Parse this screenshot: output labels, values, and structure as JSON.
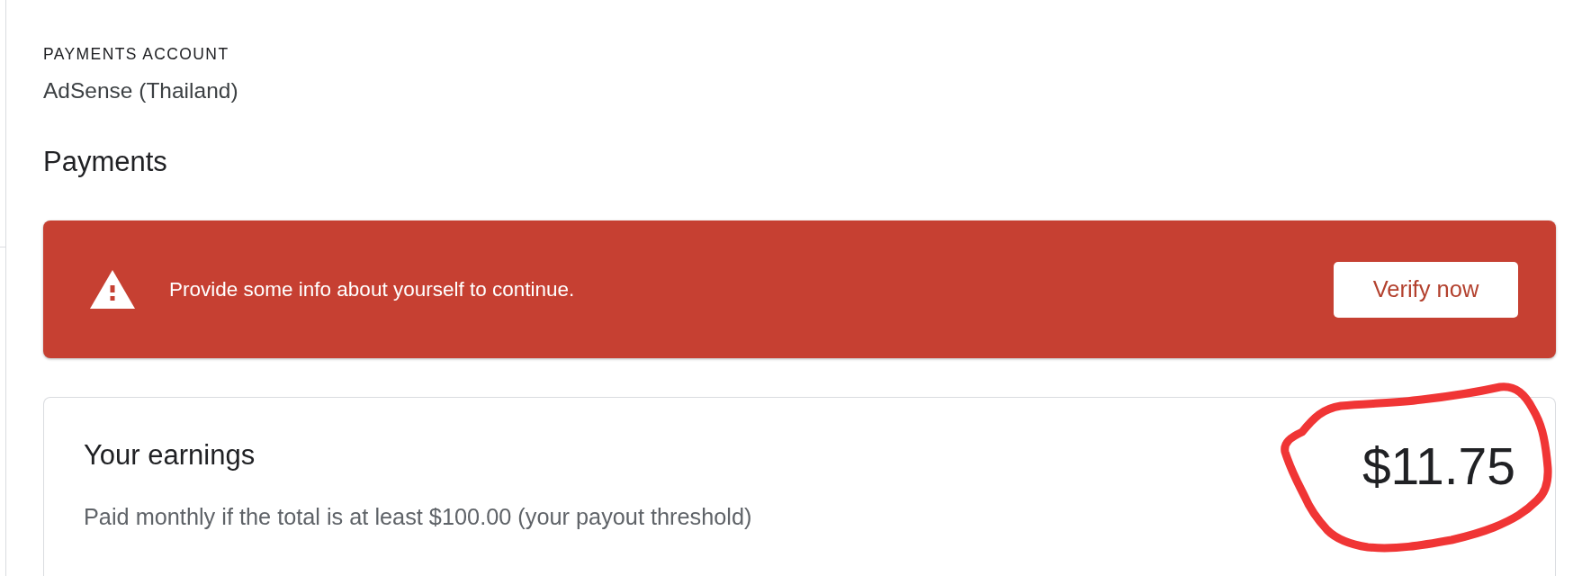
{
  "payments_account": {
    "label": "PAYMENTS ACCOUNT",
    "name": "AdSense (Thailand)"
  },
  "section_title": "Payments",
  "alert": {
    "message": "Provide some info about yourself to continue.",
    "action": "Verify now"
  },
  "earnings": {
    "title": "Your earnings",
    "note": "Paid monthly if the total is at least $100.00 (your payout threshold)",
    "amount": "$11.75"
  }
}
